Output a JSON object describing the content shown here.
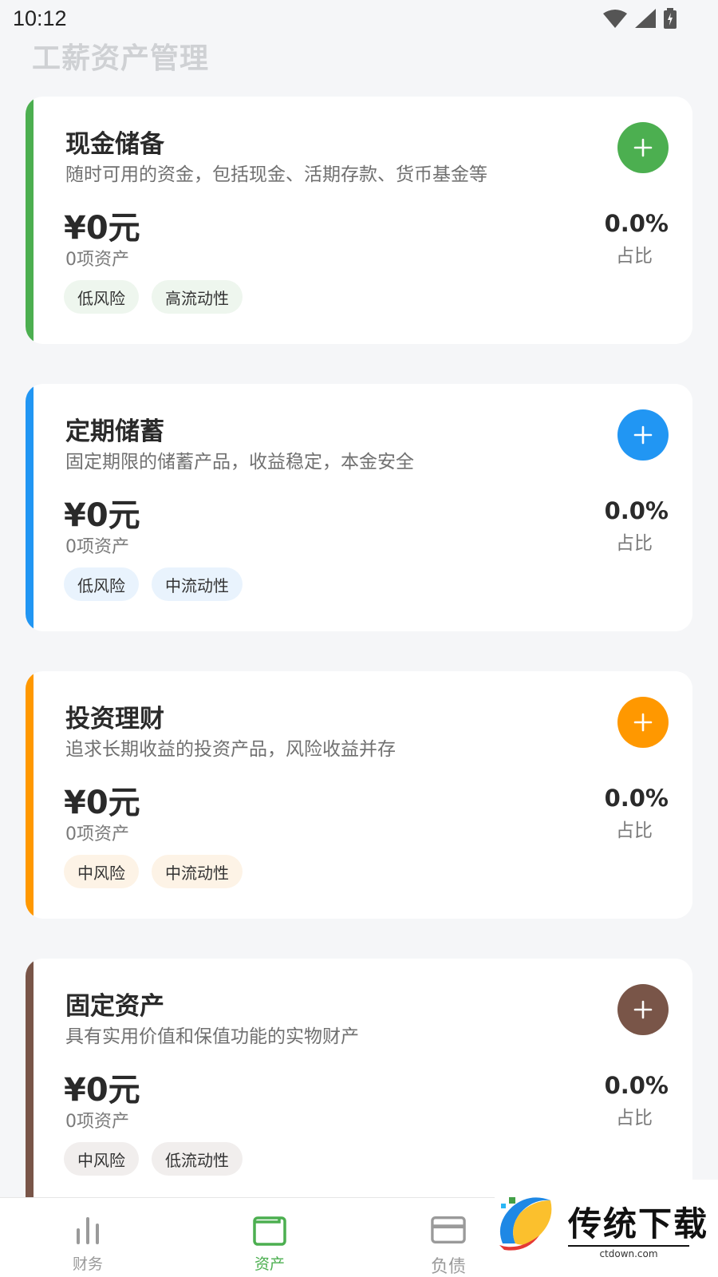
{
  "status_bar": {
    "time": "10:12"
  },
  "page_title": "工薪资产管理",
  "cards": [
    {
      "title": "现金储备",
      "description": "随时可用的资金，包括现金、活期存款、货币基金等",
      "amount": "¥0元",
      "count": "0项资产",
      "percent": "0.0%",
      "ratio_label": "占比",
      "tags": [
        "低风险",
        "高流动性"
      ],
      "accent": "#4caf50",
      "tag_bg": "#eef6ee"
    },
    {
      "title": "定期储蓄",
      "description": "固定期限的储蓄产品，收益稳定，本金安全",
      "amount": "¥0元",
      "count": "0项资产",
      "percent": "0.0%",
      "ratio_label": "占比",
      "tags": [
        "低风险",
        "中流动性"
      ],
      "accent": "#2196f3",
      "tag_bg": "#e9f3fd"
    },
    {
      "title": "投资理财",
      "description": "追求长期收益的投资产品，风险收益并存",
      "amount": "¥0元",
      "count": "0项资产",
      "percent": "0.0%",
      "ratio_label": "占比",
      "tags": [
        "中风险",
        "中流动性"
      ],
      "accent": "#ff9800",
      "tag_bg": "#fdf3e6"
    },
    {
      "title": "固定资产",
      "description": "具有实用价值和保值功能的实物财产",
      "amount": "¥0元",
      "count": "0项资产",
      "percent": "0.0%",
      "ratio_label": "占比",
      "tags": [
        "中风险",
        "低流动性"
      ],
      "accent": "#795548",
      "tag_bg": "#f1eeed"
    }
  ],
  "bottom_nav": [
    {
      "label": "财务",
      "icon": "bar-chart-icon",
      "color": "#9a9a9a"
    },
    {
      "label": "资产",
      "icon": "wallet-icon",
      "color": "#4caf50",
      "active": true
    },
    {
      "label": "负债",
      "icon": "credit-card-icon",
      "color": "#9a9a9a"
    }
  ],
  "watermark": {
    "text": "传统下载",
    "sub": "ctdown.com"
  }
}
